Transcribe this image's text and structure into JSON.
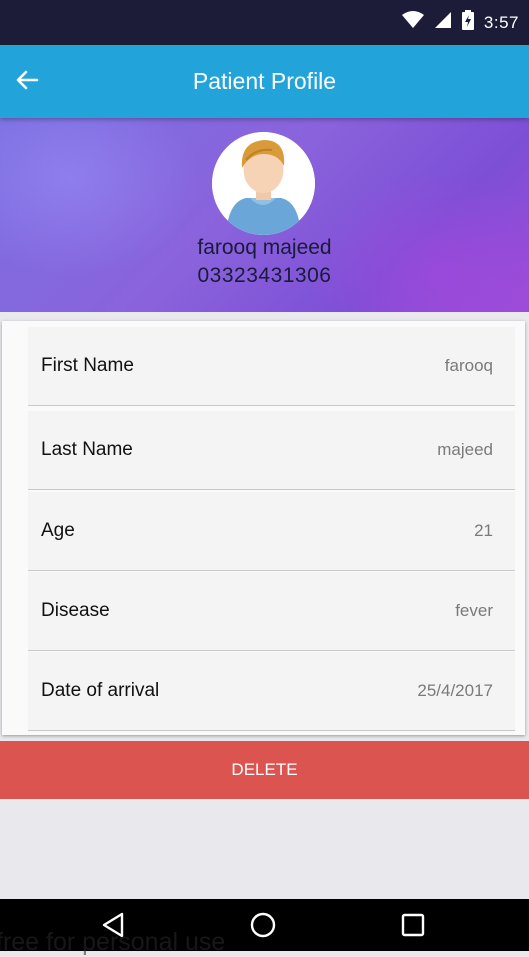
{
  "status_bar": {
    "time": "3:57"
  },
  "app_bar": {
    "title": "Patient Profile"
  },
  "profile": {
    "name": "farooq majeed",
    "phone": "03323431306"
  },
  "fields": [
    {
      "label": "First Name",
      "value": "farooq"
    },
    {
      "label": "Last Name",
      "value": "majeed"
    },
    {
      "label": "Age",
      "value": "21"
    },
    {
      "label": "Disease",
      "value": "fever"
    },
    {
      "label": "Date of arrival",
      "value": "25/4/2017"
    }
  ],
  "actions": {
    "delete_label": "DELETE"
  },
  "watermark": "free for personal use",
  "colors": {
    "app_bar": "#22a4da",
    "delete": "#dc5450",
    "header_purple": "#8a63dc"
  }
}
